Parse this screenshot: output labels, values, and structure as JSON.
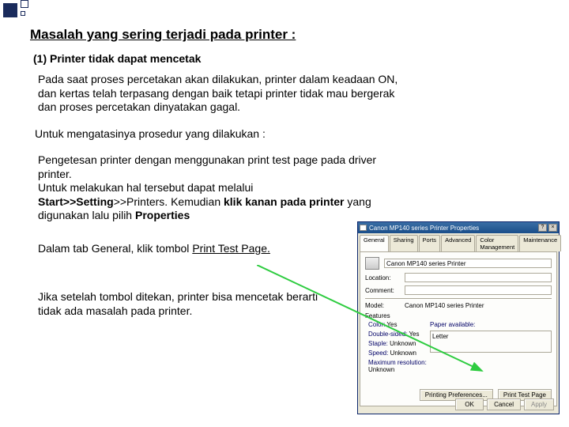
{
  "header": {
    "title": "Masalah yang sering terjadi pada printer :",
    "subhead": "(1) Printer tidak dapat mencetak"
  },
  "paragraphs": {
    "p1": "Pada saat proses  percetakan akan dilakukan, printer dalam keadaan ON, dan kertas telah terpasang dengan baik tetapi printer tidak mau bergerak  dan  proses  percetakan dinyatakan gagal.",
    "p2": "Untuk mengatasinya prosedur yang dilakukan :",
    "p3_a": "Pengetesan printer dengan menggunakan print test page pada driver printer.",
    "p3_b": "Untuk melakukan hal tersebut dapat melalui ",
    "p3_bold1": "Start>>Setting",
    "p3_mid": ">>Printers. Kemudian ",
    "p3_bold2": "klik  kanan pada printer",
    "p3_c": " yang digunakan lalu pilih ",
    "p3_bold3": "Properties",
    "p4_a": "Dalam tab General, klik tombol ",
    "p4_u": "Print Test Page.",
    "p5": "Jika  setelah tombol ditekan, printer bisa mencetak berarti tidak ada masalah pada printer."
  },
  "dialog": {
    "title": "Canon MP140 series Printer Properties",
    "tabs": [
      "General",
      "Sharing",
      "Ports",
      "Advanced",
      "Color Management",
      "Maintenance"
    ],
    "printer_name": "Canon MP140 series Printer",
    "labels": {
      "location": "Location:",
      "comment": "Comment:",
      "model": "Model:",
      "features": "Features"
    },
    "model_value": "Canon MP140 series Printer",
    "features": {
      "color_k": "Color:",
      "color_v": "Yes",
      "double_k": "Double-sided:",
      "double_v": "Yes",
      "staple_k": "Staple:",
      "staple_v": "Unknown",
      "speed_k": "Speed:",
      "speed_v": "Unknown",
      "maxres_k": "Maximum resolution:",
      "maxres_v": "Unknown",
      "paper_k": "Paper available:",
      "paper_v": "Letter"
    },
    "buttons": {
      "printing_prefs": "Printing Preferences...",
      "print_test": "Print Test Page",
      "ok": "OK",
      "cancel": "Cancel",
      "apply": "Apply"
    }
  }
}
